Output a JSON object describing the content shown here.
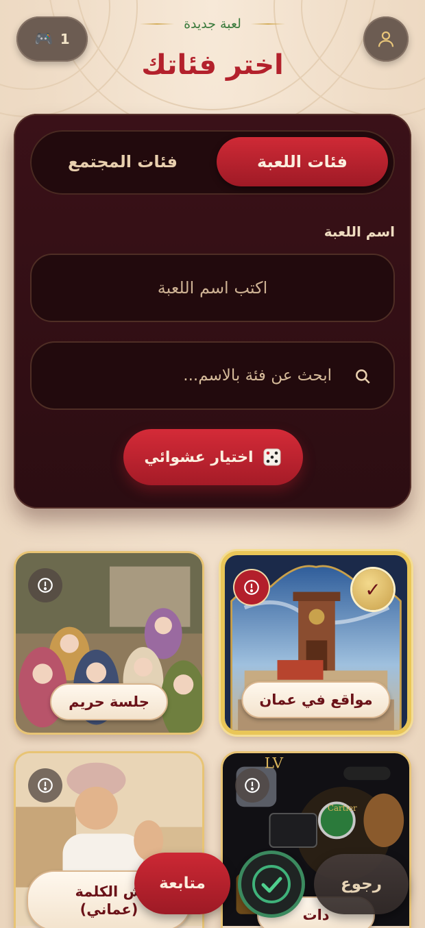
{
  "header": {
    "subtitle": "لعبة جديدة",
    "title": "اختر فئاتك",
    "games_count": "1",
    "games_icon": "gamepad-icon",
    "profile_icon": "user-icon"
  },
  "tabs": {
    "active": "فئات اللعبة",
    "inactive": "فئات المجتمع"
  },
  "game_name": {
    "label": "اسم اللعبة",
    "placeholder": "اكتب اسم اللعبة",
    "value": ""
  },
  "search": {
    "placeholder": "ابحث عن فئة بالاسم...",
    "icon": "search-icon"
  },
  "random_button": {
    "label": "اختيار عشوائي",
    "icon": "dice-icon"
  },
  "categories": [
    {
      "label": "مواقع في عمان",
      "selected": true,
      "check": "✓",
      "icon": "info-icon"
    },
    {
      "label": "جلسة حريم",
      "selected": false,
      "icon": "info-icon"
    },
    {
      "label": "دات",
      "selected": false,
      "icon": "info-icon"
    },
    {
      "label": "ش الكلمة (عماني)",
      "selected": false,
      "icon": "info-icon"
    }
  ],
  "actions": {
    "continue": "متابعة",
    "back": "رجوع",
    "confirm_icon": "check-icon"
  },
  "colors": {
    "accent_red": "#b3212c",
    "panel": "#2c0d12",
    "gold": "#e9c658",
    "green": "#3a7a3c"
  }
}
